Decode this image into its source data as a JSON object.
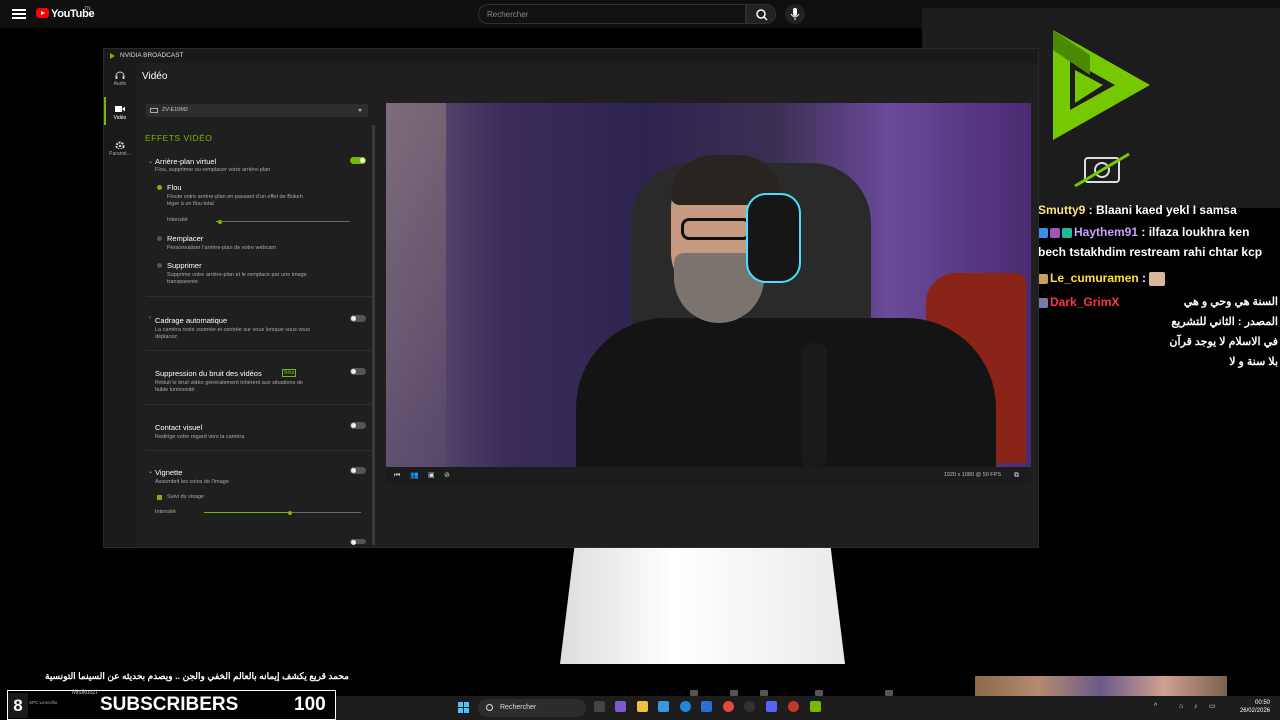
{
  "youtube": {
    "logo_text": "YouTube",
    "logo_sup": "TN",
    "search_placeholder": "Rechercher"
  },
  "nvidia": {
    "title": "NVIDIA BROADCAST",
    "sidebar": [
      {
        "label": "Audio",
        "icon": "headphones-icon"
      },
      {
        "label": "Vidéo",
        "icon": "video-camera-icon"
      },
      {
        "label": "Paramè...",
        "icon": "gear-icon"
      }
    ],
    "header": "Vidéo",
    "device": "ZV-E10M2",
    "section_title": "EFFETS VIDÉO",
    "effects": {
      "bg_title": "Arrière-plan virtuel",
      "bg_desc": "Flou, supprimer ou remplacer votre arrière-plan",
      "blur_title": "Flou",
      "blur_desc_1": "Floute votre arrière-plan en passant d'un effet de Bokeh",
      "blur_desc_2": "léger à un flou total",
      "blur_intensity_label": "Intensité",
      "blur_intensity": 0.03,
      "replace_title": "Remplacer",
      "replace_desc": "Personnaliser l'arrière-plan de votre webcam",
      "remove_title": "Supprimer",
      "remove_desc_1": "Supprime votre arrière-plan et le remplace par une image",
      "remove_desc_2": "transparente",
      "frame_title": "Cadrage automatique",
      "frame_desc_1": "La caméra reste zoomée et centrée sur vous lorsque vous vous",
      "frame_desc_2": "déplacez",
      "noise_title": "Suppression du bruit des vidéos",
      "noise_badge": "Bêta",
      "noise_desc_1": "Réduit le bruit vidéo généralement inhérent aux situations de",
      "noise_desc_2": "faible luminosité",
      "eye_title": "Contact visuel",
      "eye_desc": "Redirige votre regard vers la caméra",
      "vignette_title": "Vignette",
      "vignette_desc": "Assombrit les coins de l'image",
      "face_track_label": "Suivi du visage",
      "vignette_intensity_label": "Intensité",
      "vignette_intensity": 0.55
    },
    "resolution": "1920 x 1080 @ 50 FPS"
  },
  "chat": [
    {
      "user": "Smutty9",
      "text": "Blaani kaed yekl I samsa"
    },
    {
      "user": "Haythem91",
      "text": "ilfaza loukhra ken bech tstakhdim restream rahi chtar kcp"
    },
    {
      "user": "Le_cumuramen",
      "text": ":"
    },
    {
      "user": "Dark_GrimX",
      "text": "السنة هي وحي و هي المصدر : الثاني للتشريع في الاسلام لا يوجد قرآن بلا سنة و لا"
    }
  ],
  "news": {
    "headline": "محمد قريع يكشف إيمانه بالعالم الخفي والجن .. ويصدم بحديثه عن السينما التونسية"
  },
  "subscribers": {
    "badge_num": "8",
    "small_text": "SPC Leocellio",
    "user": "Misfkouzi",
    "label": "SUBSCRIBERS",
    "count": "100"
  },
  "taskbar": {
    "search_placeholder": "Rechercher",
    "time": "00:50",
    "date": "26/02/2026"
  },
  "colors": {
    "nvidia_green": "#76b900",
    "yt_red": "#ff0000"
  }
}
